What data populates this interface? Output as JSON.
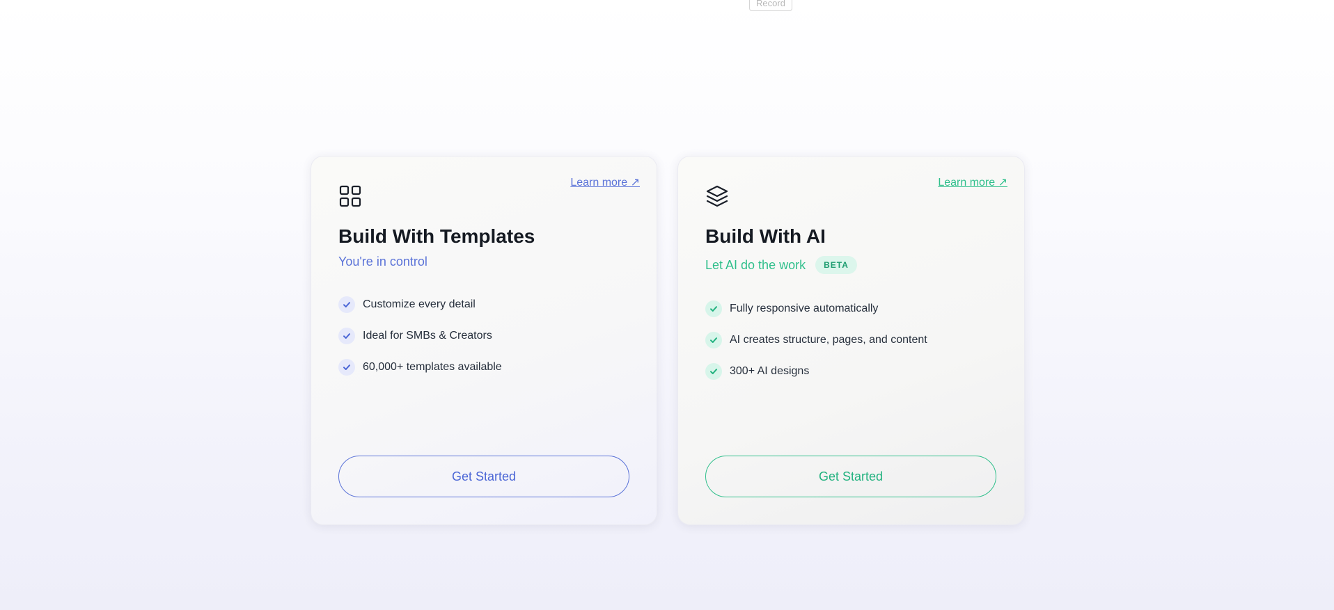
{
  "top": {
    "record_label": "Record"
  },
  "cards": [
    {
      "icon": "grid-icon",
      "learn_more": "Learn more ↗",
      "title": "Build With Templates",
      "subtitle": "You're in control",
      "features": [
        "Customize every detail",
        "Ideal for SMBs & Creators",
        "60,000+ templates available"
      ],
      "cta": "Get Started",
      "accent": "#5b73d8"
    },
    {
      "icon": "layers-icon",
      "learn_more": "Learn more ↗",
      "title": "Build With AI",
      "subtitle": "Let AI do the work",
      "badge": "BETA",
      "features": [
        "Fully responsive automatically",
        "AI creates structure, pages, and content",
        "300+ AI designs"
      ],
      "cta": "Get Started",
      "accent": "#2fbf8b"
    }
  ]
}
